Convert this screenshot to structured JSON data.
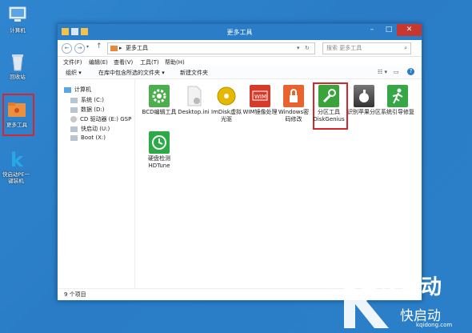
{
  "desktop": {
    "icons": [
      {
        "label": "计算机",
        "icon": "computer-icon"
      },
      {
        "label": "回收站",
        "icon": "recycle-bin-icon"
      },
      {
        "label": "更多工具",
        "icon": "folder-icon"
      },
      {
        "label": "快启动PE一键装机",
        "icon": "kqidong-k-icon"
      }
    ]
  },
  "window": {
    "title": "更多工具",
    "address": "更多工具",
    "search_placeholder": "搜索 更多工具",
    "menu": [
      "文件(F)",
      "编辑(E)",
      "查看(V)",
      "工具(T)",
      "帮助(H)"
    ],
    "toolbar": [
      "组织 ▾",
      "在库中包含所选的文件夹 ▾",
      "新建文件夹"
    ],
    "nav": [
      "计算机",
      "系统 (C:)",
      "数据 (D:)",
      "CD 驱动器 (E:) GSP",
      "快启动 (U:)",
      "Boot (X:)"
    ],
    "items": [
      {
        "label": "BCD编辑工具",
        "icon": "gear-icon",
        "color": "#4cae4f"
      },
      {
        "label": "Desktop.ini",
        "icon": "file-icon",
        "color": "#e9e9e9"
      },
      {
        "label": "ImDisk虚拟光驱",
        "icon": "cd-icon",
        "color": "#e6b800"
      },
      {
        "label": "WIM镜像处理",
        "icon": "wim-icon",
        "color": "#d63a2a"
      },
      {
        "label": "Windows密码修改",
        "icon": "lock-icon",
        "color": "#e8632d"
      },
      {
        "label": "分区工具DiskGenius",
        "icon": "wrench-icon",
        "color": "#3aa33c"
      },
      {
        "label": "识别苹果分区",
        "icon": "apple-icon",
        "color": "#555555"
      },
      {
        "label": "系统引导修复",
        "icon": "runner-icon",
        "color": "#36a646"
      },
      {
        "label": "硬盘检测HDTune",
        "icon": "clock-icon",
        "color": "#2daa48"
      }
    ],
    "status": "9 个项目"
  },
  "watermark": {
    "brand": "快启动",
    "url": "kqidong.com"
  },
  "colors": {
    "desktop": "#2b7fc9",
    "titlebar": "#2b7dc7",
    "highlight": "#d9262c",
    "close": "#c7372f"
  }
}
